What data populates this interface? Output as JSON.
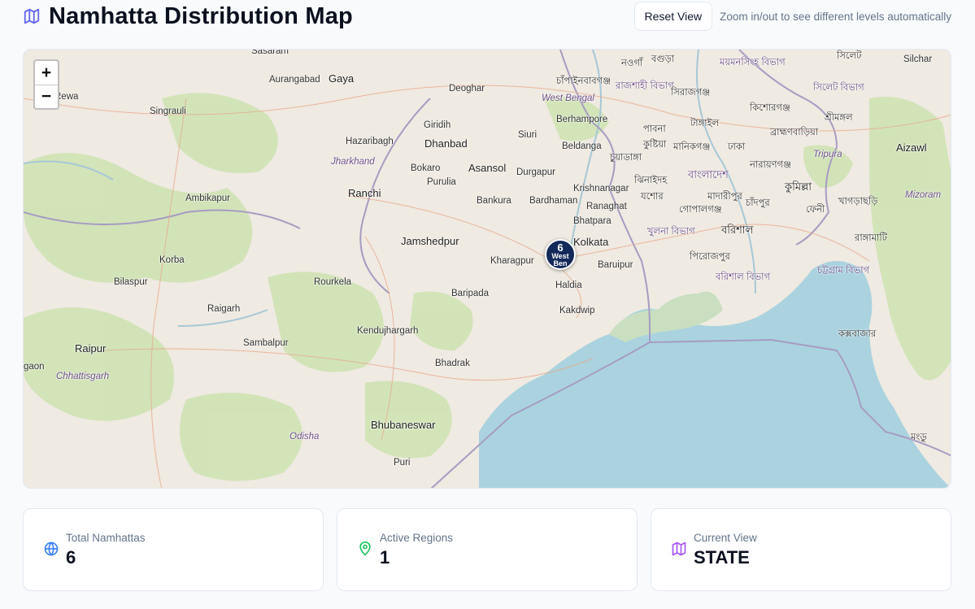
{
  "header": {
    "title": "Namhatta Distribution Map",
    "reset_label": "Reset View",
    "hint": "Zoom in/out to see different levels automatically"
  },
  "map": {
    "zoom_in": "+",
    "zoom_out": "−",
    "labels": [
      "Gaya",
      "Aurangabad",
      "Sasaram",
      "Deoghar",
      "Singrauli",
      "Rewa",
      "Giridih",
      "Hazaribagh",
      "Dhanbad",
      "Jharkhand",
      "Bokaro",
      "Asansol",
      "Purulia",
      "Ranchi",
      "Ambikapur",
      "Durgapur",
      "Siuri",
      "Berhampore",
      "Beldanga",
      "West Bengal",
      "Bankura",
      "Bardhaman",
      "Krishnanagar",
      "Ranaghat",
      "Bhatpara",
      "Kolkata",
      "Jamshedpur",
      "Korba",
      "Kharagpur",
      "Baruipur",
      "Bilaspur",
      "Rourkela",
      "Haldia",
      "Baripada",
      "Raigarh",
      "Kakdwip",
      "Kendujhargarh",
      "Sambalpur",
      "Raipur",
      "Bhadrak",
      "Chhattisgarh",
      "Bhubaneswar",
      "Odisha",
      "Puri",
      "Silchar",
      "Aizawl",
      "Tripura",
      "Mizoram",
      "gaon"
    ],
    "bengali_labels": [
      "নওগাঁ",
      "বগুড়া",
      "ময়মনসিংহ বিভাগ",
      "সিলেট",
      "চাঁপাইনবাবগঞ্জ",
      "রাজশাহী বিভাগ",
      "সিরাজগঞ্জ",
      "সিলেট বিভাগ",
      "কিশোরগঞ্জ",
      "শ্রীমঙ্গল",
      "টাঙ্গাইল",
      "পাবনা",
      "কুষ্টিয়া",
      "মানিকগঞ্জ",
      "ঢাকা",
      "ব্রাহ্মণবাড়িয়া",
      "চুয়াডাঙ্গা",
      "নারায়ণগঞ্জ",
      "ঝিনাইদহ",
      "বাংলাদেশ",
      "যশোর",
      "মাদারীপুর",
      "কুমিল্লা",
      "চাঁদপুর",
      "খাগড়াছড়ি",
      "গোপালগঞ্জ",
      "ফেনী",
      "খুলনা বিভাগ",
      "বরিশাল",
      "রাঙ্গামাটি",
      "পিরোজপুর",
      "বরিশাল বিভাগ",
      "চট্টগ্রাম বিভাগ",
      "কক্সবাজার",
      "মংডু"
    ],
    "marker": {
      "count": "6",
      "name": "West Ben"
    }
  },
  "stats": [
    {
      "label": "Total Namhattas",
      "value": "6",
      "icon": "globe-icon",
      "color": "#3b82f6"
    },
    {
      "label": "Active Regions",
      "value": "1",
      "icon": "map-pin-icon",
      "color": "#22c55e"
    },
    {
      "label": "Current View",
      "value": "STATE",
      "icon": "map-icon",
      "color": "#a855f7"
    }
  ]
}
